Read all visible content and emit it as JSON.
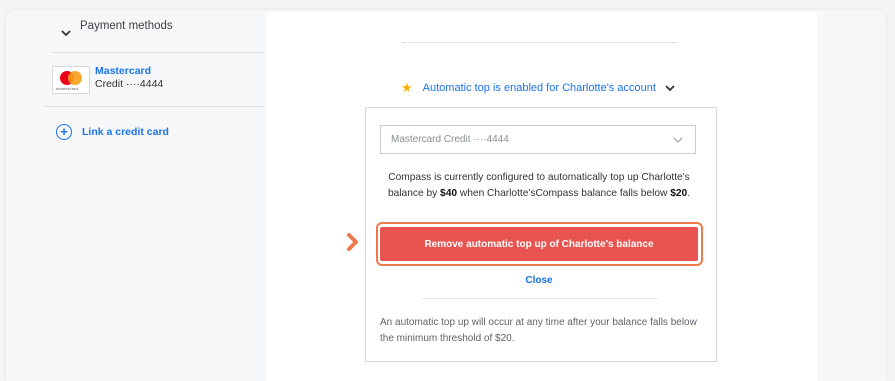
{
  "sidebar": {
    "section_label": "Payment methods",
    "card": {
      "logo_text": "mastercard",
      "name": "Mastercard",
      "number": "Credit ····4444"
    },
    "link_card_label": "Link a credit card"
  },
  "main": {
    "auto_status": "Automatic top is enabled for Charlotte's account",
    "select_value": "Mastercard Credit ····4444",
    "desc_1": "Compass is currently configured to automatically top up Charlotte's balance by ",
    "desc_amount": "$40",
    "desc_2": " when Charlotte'sCompass balance falls below ",
    "desc_threshold": "$20",
    "desc_3": ".",
    "remove_button": "Remove automatic top up of Charlotte's balance",
    "close_link": "Close",
    "note": "An automatic top up will occur at any time after your balance falls below the minimum threshold of $20."
  },
  "colors": {
    "accent": "#1a73e8",
    "danger": "#e85450",
    "highlight": "#ee7a4b",
    "star": "#f5b400"
  }
}
